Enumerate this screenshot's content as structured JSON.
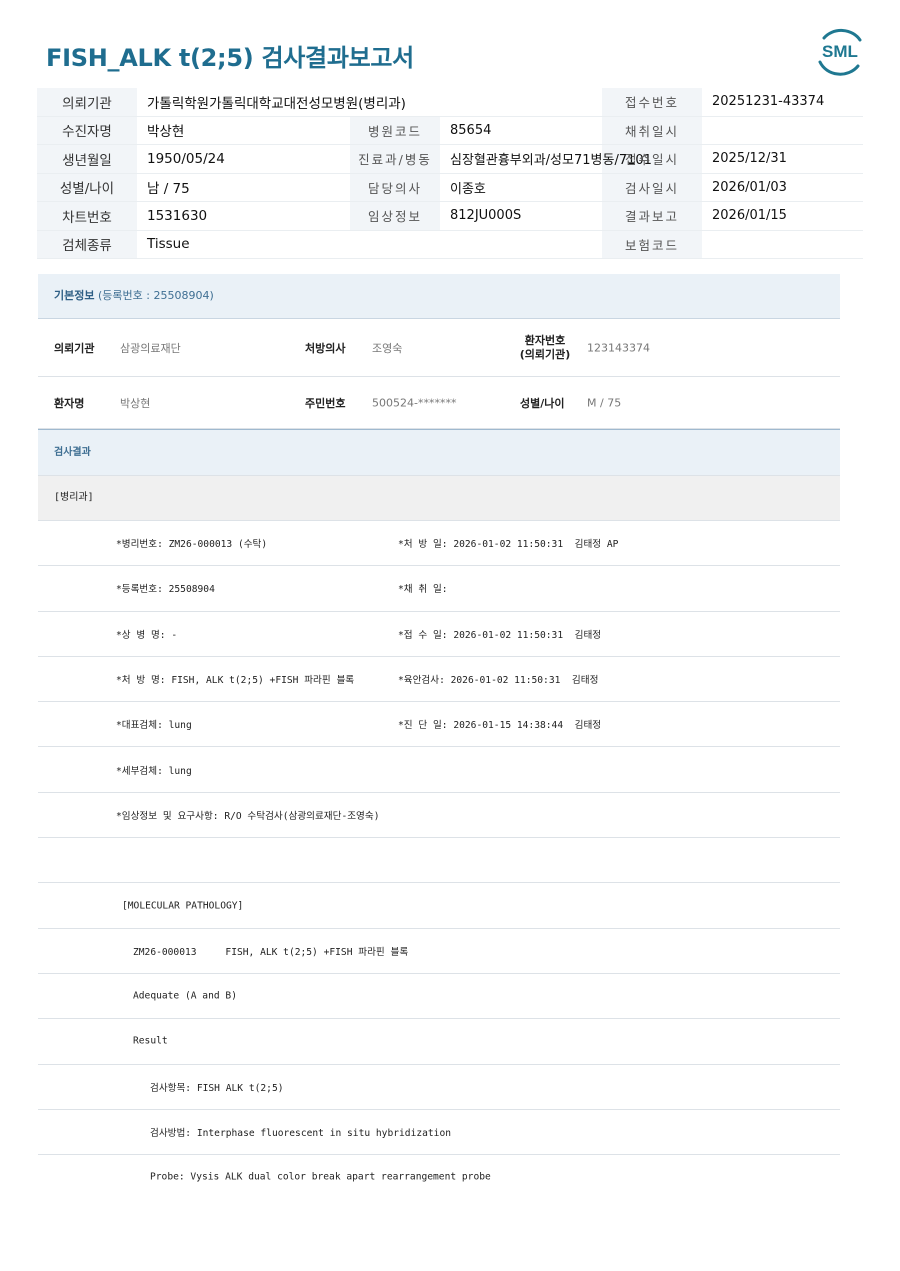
{
  "title": "FISH_ALK t(2;5) 검사결과보고서",
  "logo_text": "SML",
  "header": {
    "rows": [
      {
        "l1": "의뢰기관",
        "v1": "가톨릭학원가톨릭대학교대전성모병원(병리과)",
        "l2": "",
        "v2": "",
        "l3": "접수번호",
        "v3": "20251231-43374"
      },
      {
        "l1": "수진자명",
        "v1": "박상현",
        "l2": "병원코드",
        "v2": "85654",
        "l3": "채취일시",
        "v3": ""
      },
      {
        "l1": "생년월일",
        "v1": "1950/05/24",
        "l2": "진료과/병동",
        "v2": "심장혈관흉부외과/성모71병동/7101",
        "l3": "접수일시",
        "v3": "2025/12/31"
      },
      {
        "l1": "성별/나이",
        "v1": "남 / 75",
        "l2": "담당의사",
        "v2": "이종호",
        "l3": "검사일시",
        "v3": "2026/01/03"
      },
      {
        "l1": "차트번호",
        "v1": "1531630",
        "l2": "임상정보",
        "v2": "812JU000S",
        "l3": "결과보고",
        "v3": "2026/01/15"
      },
      {
        "l1": "검체종류",
        "v1": "Tissue",
        "l2": "",
        "v2": "",
        "l3": "보험코드",
        "v3": ""
      }
    ]
  },
  "basic": {
    "title": "기본정보",
    "reg": "(등록번호 : 25508904)",
    "r1": {
      "l1": "의뢰기관",
      "v1": "삼광의료재단",
      "l2": "처방의사",
      "v2": "조영숙",
      "l3a": "환자번호",
      "l3b": "(의뢰기관)",
      "v3": "123143374"
    },
    "r2": {
      "l1": "환자명",
      "v1": "박상현",
      "l2": "주민번호",
      "v2": "500524-*******",
      "l3": "성별/나이",
      "v3": "M / 75"
    }
  },
  "results": {
    "title": "검사결과",
    "dept": "[병리과]",
    "rows": [
      {
        "left": "*병리번호: ZM26-000013 (수탁)",
        "right": "*처 방 일: 2026-01-02 11:50:31  김태정 AP"
      },
      {
        "left": "*등록번호: 25508904",
        "right": "*채 취 일:"
      },
      {
        "left": "*상 병 명: -",
        "right": "*접 수 일: 2026-01-02 11:50:31  김태정"
      },
      {
        "left": "*처 방 명: FISH, ALK t(2;5) +FISH 파라핀 블록",
        "right": "*육안검사: 2026-01-02 11:50:31  김태정"
      },
      {
        "left": "*대표검체: lung",
        "right": "*진 단 일: 2026-01-15 14:38:44  김태정"
      },
      {
        "left": "*세부검체: lung",
        "right": ""
      },
      {
        "left": "*임상정보 및 요구사항: R/O 수탁검사(삼광의료재단-조영숙)",
        "right": ""
      },
      {
        "left": "",
        "right": ""
      }
    ],
    "mol_rows": [
      "[MOLECULAR PATHOLOGY]",
      "ZM26-000013     FISH, ALK t(2;5) +FISH 파라핀 블록",
      "Adequate (A and B)",
      "Result",
      "검사항목: FISH ALK t(2;5)",
      "검사방법: Interphase fluorescent in situ hybridization",
      "Probe: Vysis ALK dual color break apart rearrangement probe"
    ]
  },
  "colors": {
    "title": "#1f6d8f",
    "logo": "#1f7891",
    "panel_bg": "#eaf1f7",
    "label_bg": "#f2f5f8"
  }
}
